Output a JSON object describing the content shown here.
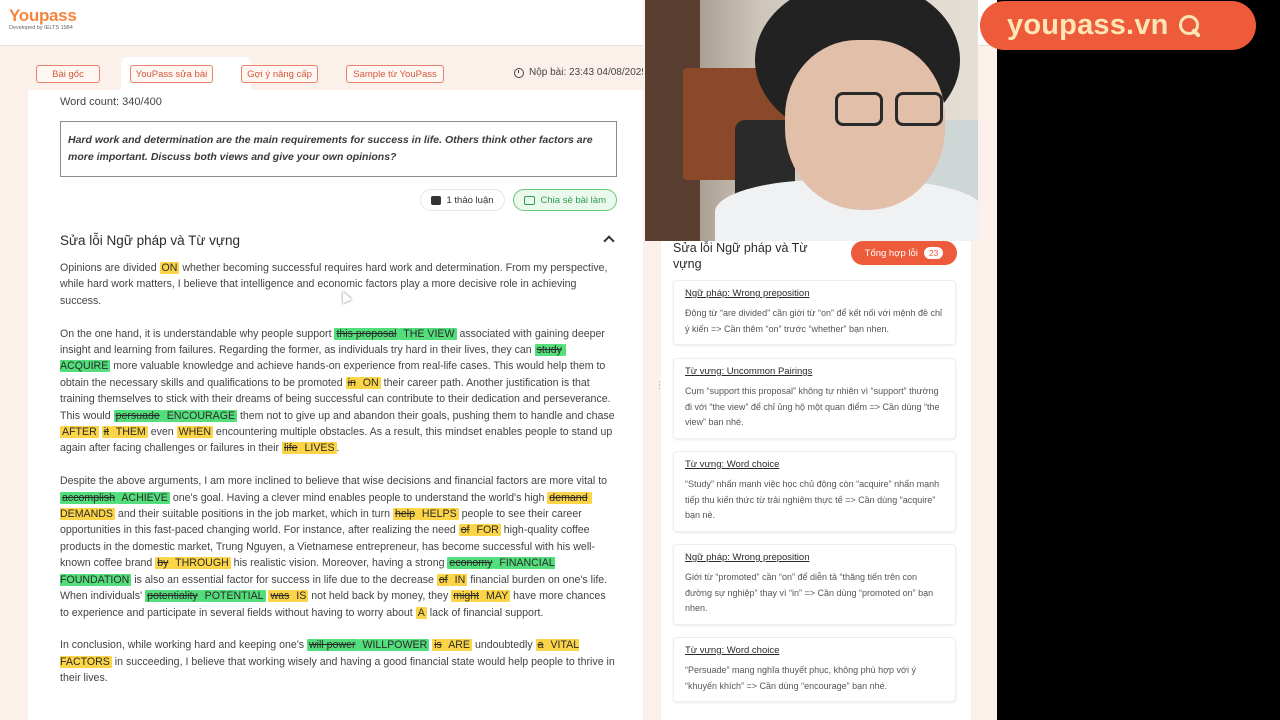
{
  "brand": {
    "name": "Youpass",
    "sub": "Developed by IELTS 1984",
    "badge": "youpass.vn"
  },
  "tabs": [
    {
      "label": "Bài gốc"
    },
    {
      "label": "YouPass sửa bài"
    },
    {
      "label": "Gợi ý nâng cấp"
    },
    {
      "label": "Sample từ YouPass"
    }
  ],
  "submit": "Nộp bài: 23:43 04/08/2025",
  "wordcount": "Word count: 340/400",
  "prompt": "Hard work and determination are the main requirements for success in life. Others think other factors are more important. Discuss both views and give your own opinions?",
  "actions": {
    "discuss": "1 thảo luận",
    "share": "Chia sẻ bài làm"
  },
  "section_title": "Sửa lỗi Ngữ pháp và Từ vựng",
  "essay": {
    "p1": [
      {
        "t": "Opinions are divided "
      },
      {
        "t": "ON",
        "h": "y"
      },
      {
        "t": " whether becoming successful requires hard work and determination. From my perspective, while hard work matters, I believe that intelligence and economic factors play a more decisive role in achieving success."
      }
    ],
    "p2": [
      {
        "t": "On the one hand, it is understandable why people support "
      },
      {
        "t": "this proposal",
        "h": "g",
        "s": true
      },
      {
        "t": " THE VIEW",
        "h": "g"
      },
      {
        "t": " associated with gaining deeper insight and learning from failures. Regarding the former, as individuals try hard in their lives, they can "
      },
      {
        "t": "study",
        "h": "g",
        "s": true
      },
      {
        "t": " ACQUIRE",
        "h": "g"
      },
      {
        "t": " more valuable knowledge and achieve hands-on experience from real-life cases. This would help them to obtain the necessary skills and qualifications to be promoted "
      },
      {
        "t": "in",
        "h": "y",
        "s": true
      },
      {
        "t": " ON",
        "h": "y"
      },
      {
        "t": " their career path. Another justification is that training themselves to stick with their dreams of being successful can contribute to their dedication and perseverance. This would "
      },
      {
        "t": "persuade",
        "h": "g",
        "s": true
      },
      {
        "t": " ENCOURAGE",
        "h": "g"
      },
      {
        "t": " them not to give up and abandon their goals, pushing them to handle and chase "
      },
      {
        "t": "AFTER",
        "h": "y"
      },
      {
        "t": " "
      },
      {
        "t": "it",
        "h": "y",
        "s": true
      },
      {
        "t": " THEM",
        "h": "y"
      },
      {
        "t": " even "
      },
      {
        "t": "WHEN",
        "h": "y"
      },
      {
        "t": " encountering multiple obstacles. As a result, this mindset enables people to stand up again after facing challenges or failures in their "
      },
      {
        "t": "life",
        "h": "y",
        "s": true
      },
      {
        "t": " LIVES",
        "h": "y"
      },
      {
        "t": "."
      }
    ],
    "p3": [
      {
        "t": "Despite the above arguments, I am more inclined to believe that wise decisions and financial factors are more vital to "
      },
      {
        "t": "accomplish",
        "h": "g",
        "s": true
      },
      {
        "t": " ACHIEVE",
        "h": "g"
      },
      {
        "t": " one's goal. Having a clever mind enables people to understand the world's high "
      },
      {
        "t": "demand",
        "h": "y",
        "s": true
      },
      {
        "t": " DEMANDS",
        "h": "y"
      },
      {
        "t": " and their suitable positions in the job market, which in turn "
      },
      {
        "t": "help",
        "h": "y",
        "s": true
      },
      {
        "t": " HELPS",
        "h": "y"
      },
      {
        "t": " people to see their career opportunities in this fast-paced changing world. For instance, after realizing the need "
      },
      {
        "t": "of",
        "h": "y",
        "s": true
      },
      {
        "t": " FOR",
        "h": "y"
      },
      {
        "t": " high-quality coffee products in the domestic market, Trung Nguyen, a Vietnamese entrepreneur, has become successful with his well-known coffee brand "
      },
      {
        "t": "by",
        "h": "y",
        "s": true
      },
      {
        "t": " THROUGH",
        "h": "y"
      },
      {
        "t": " his realistic vision. Moreover, having a strong "
      },
      {
        "t": "economy",
        "h": "g",
        "s": true
      },
      {
        "t": " FINANCIAL FOUNDATION",
        "h": "g"
      },
      {
        "t": " is also an essential factor for success in life due to the decrease "
      },
      {
        "t": "of",
        "h": "y",
        "s": true
      },
      {
        "t": " IN",
        "h": "y"
      },
      {
        "t": " financial burden on one's life. When individuals' "
      },
      {
        "t": "potentiality",
        "h": "g",
        "s": true
      },
      {
        "t": " POTENTIAL",
        "h": "g"
      },
      {
        "t": " "
      },
      {
        "t": "was",
        "h": "y",
        "s": true
      },
      {
        "t": " IS",
        "h": "y"
      },
      {
        "t": " not held back by money, they "
      },
      {
        "t": "might",
        "h": "y",
        "s": true
      },
      {
        "t": " MAY",
        "h": "y"
      },
      {
        "t": " have more chances to experience and participate in several fields without having to worry about "
      },
      {
        "t": "A",
        "h": "y"
      },
      {
        "t": " lack of financial support."
      }
    ],
    "p4": [
      {
        "t": "In conclusion, while working hard and keeping one's "
      },
      {
        "t": "will power",
        "h": "g",
        "s": true
      },
      {
        "t": " WILLPOWER",
        "h": "g"
      },
      {
        "t": " "
      },
      {
        "t": "is",
        "h": "y",
        "s": true
      },
      {
        "t": " ARE",
        "h": "y"
      },
      {
        "t": " undoubtedly "
      },
      {
        "t": "a",
        "h": "y",
        "s": true
      },
      {
        "t": " VITAL FACTORS",
        "h": "y"
      },
      {
        "t": " in succeeding, I believe that working wisely and having a good financial state would help people to thrive in their lives."
      }
    ]
  },
  "sidebar": {
    "title": "Sửa lỗi Ngữ pháp và Từ vựng",
    "summary_label": "Tổng hợp lỗi",
    "summary_count": "23",
    "cards": [
      {
        "title": "Ngữ pháp: Wrong preposition",
        "body": "Động từ “are divided” cần giới từ “on” để kết nối với mệnh đề chỉ ý kiến => Cần thêm “on” trước “whether” bạn nhen."
      },
      {
        "title": "Từ vựng: Uncommon Pairings",
        "body": "Cụm “support this proposal” không tự nhiên vì “support” thường đi với “the view” để chỉ ủng hộ một quan điểm => Cần dùng “the view” bạn nhé."
      },
      {
        "title": "Từ vựng: Word choice",
        "body": "“Study” nhấn mạnh việc học chủ động còn “acquire” nhấn mạnh tiếp thu kiến thức từ trải nghiệm thực tế => Cần dùng “acquire” bạn nè."
      },
      {
        "title": "Ngữ pháp: Wrong preposition",
        "body": "Giới từ “promoted” cần “on” để diễn tả “thăng tiến trên con đường sự nghiệp” thay vì “in” => Cần dùng “promoted on” bạn nhen."
      },
      {
        "title": "Từ vựng: Word choice",
        "body": "“Persuade” mang nghĩa thuyết phục, không phù hợp với ý “khuyến khích” => Cần dùng “encourage” bạn nhé."
      }
    ]
  },
  "colors": {
    "accent": "#ee5b3a",
    "highlight_yellow": "#fcd447",
    "highlight_green": "#53de7b",
    "share_green": "#2e9d4d"
  },
  "icons": [
    "clock-icon",
    "chat-icon",
    "share-icon",
    "chevron-up-icon",
    "search-icon"
  ]
}
